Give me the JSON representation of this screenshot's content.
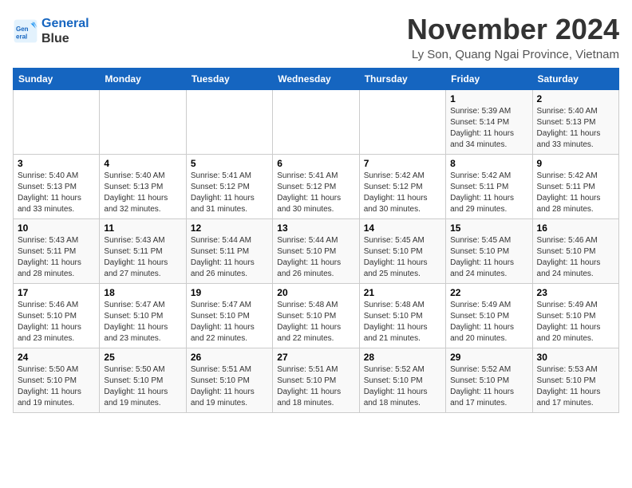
{
  "logo": {
    "line1": "General",
    "line2": "Blue"
  },
  "title": "November 2024",
  "location": "Ly Son, Quang Ngai Province, Vietnam",
  "weekdays": [
    "Sunday",
    "Monday",
    "Tuesday",
    "Wednesday",
    "Thursday",
    "Friday",
    "Saturday"
  ],
  "weeks": [
    [
      {
        "day": "",
        "info": ""
      },
      {
        "day": "",
        "info": ""
      },
      {
        "day": "",
        "info": ""
      },
      {
        "day": "",
        "info": ""
      },
      {
        "day": "",
        "info": ""
      },
      {
        "day": "1",
        "info": "Sunrise: 5:39 AM\nSunset: 5:14 PM\nDaylight: 11 hours and 34 minutes."
      },
      {
        "day": "2",
        "info": "Sunrise: 5:40 AM\nSunset: 5:13 PM\nDaylight: 11 hours and 33 minutes."
      }
    ],
    [
      {
        "day": "3",
        "info": "Sunrise: 5:40 AM\nSunset: 5:13 PM\nDaylight: 11 hours and 33 minutes."
      },
      {
        "day": "4",
        "info": "Sunrise: 5:40 AM\nSunset: 5:13 PM\nDaylight: 11 hours and 32 minutes."
      },
      {
        "day": "5",
        "info": "Sunrise: 5:41 AM\nSunset: 5:12 PM\nDaylight: 11 hours and 31 minutes."
      },
      {
        "day": "6",
        "info": "Sunrise: 5:41 AM\nSunset: 5:12 PM\nDaylight: 11 hours and 30 minutes."
      },
      {
        "day": "7",
        "info": "Sunrise: 5:42 AM\nSunset: 5:12 PM\nDaylight: 11 hours and 30 minutes."
      },
      {
        "day": "8",
        "info": "Sunrise: 5:42 AM\nSunset: 5:11 PM\nDaylight: 11 hours and 29 minutes."
      },
      {
        "day": "9",
        "info": "Sunrise: 5:42 AM\nSunset: 5:11 PM\nDaylight: 11 hours and 28 minutes."
      }
    ],
    [
      {
        "day": "10",
        "info": "Sunrise: 5:43 AM\nSunset: 5:11 PM\nDaylight: 11 hours and 28 minutes."
      },
      {
        "day": "11",
        "info": "Sunrise: 5:43 AM\nSunset: 5:11 PM\nDaylight: 11 hours and 27 minutes."
      },
      {
        "day": "12",
        "info": "Sunrise: 5:44 AM\nSunset: 5:11 PM\nDaylight: 11 hours and 26 minutes."
      },
      {
        "day": "13",
        "info": "Sunrise: 5:44 AM\nSunset: 5:10 PM\nDaylight: 11 hours and 26 minutes."
      },
      {
        "day": "14",
        "info": "Sunrise: 5:45 AM\nSunset: 5:10 PM\nDaylight: 11 hours and 25 minutes."
      },
      {
        "day": "15",
        "info": "Sunrise: 5:45 AM\nSunset: 5:10 PM\nDaylight: 11 hours and 24 minutes."
      },
      {
        "day": "16",
        "info": "Sunrise: 5:46 AM\nSunset: 5:10 PM\nDaylight: 11 hours and 24 minutes."
      }
    ],
    [
      {
        "day": "17",
        "info": "Sunrise: 5:46 AM\nSunset: 5:10 PM\nDaylight: 11 hours and 23 minutes."
      },
      {
        "day": "18",
        "info": "Sunrise: 5:47 AM\nSunset: 5:10 PM\nDaylight: 11 hours and 23 minutes."
      },
      {
        "day": "19",
        "info": "Sunrise: 5:47 AM\nSunset: 5:10 PM\nDaylight: 11 hours and 22 minutes."
      },
      {
        "day": "20",
        "info": "Sunrise: 5:48 AM\nSunset: 5:10 PM\nDaylight: 11 hours and 22 minutes."
      },
      {
        "day": "21",
        "info": "Sunrise: 5:48 AM\nSunset: 5:10 PM\nDaylight: 11 hours and 21 minutes."
      },
      {
        "day": "22",
        "info": "Sunrise: 5:49 AM\nSunset: 5:10 PM\nDaylight: 11 hours and 20 minutes."
      },
      {
        "day": "23",
        "info": "Sunrise: 5:49 AM\nSunset: 5:10 PM\nDaylight: 11 hours and 20 minutes."
      }
    ],
    [
      {
        "day": "24",
        "info": "Sunrise: 5:50 AM\nSunset: 5:10 PM\nDaylight: 11 hours and 19 minutes."
      },
      {
        "day": "25",
        "info": "Sunrise: 5:50 AM\nSunset: 5:10 PM\nDaylight: 11 hours and 19 minutes."
      },
      {
        "day": "26",
        "info": "Sunrise: 5:51 AM\nSunset: 5:10 PM\nDaylight: 11 hours and 19 minutes."
      },
      {
        "day": "27",
        "info": "Sunrise: 5:51 AM\nSunset: 5:10 PM\nDaylight: 11 hours and 18 minutes."
      },
      {
        "day": "28",
        "info": "Sunrise: 5:52 AM\nSunset: 5:10 PM\nDaylight: 11 hours and 18 minutes."
      },
      {
        "day": "29",
        "info": "Sunrise: 5:52 AM\nSunset: 5:10 PM\nDaylight: 11 hours and 17 minutes."
      },
      {
        "day": "30",
        "info": "Sunrise: 5:53 AM\nSunset: 5:10 PM\nDaylight: 11 hours and 17 minutes."
      }
    ]
  ]
}
